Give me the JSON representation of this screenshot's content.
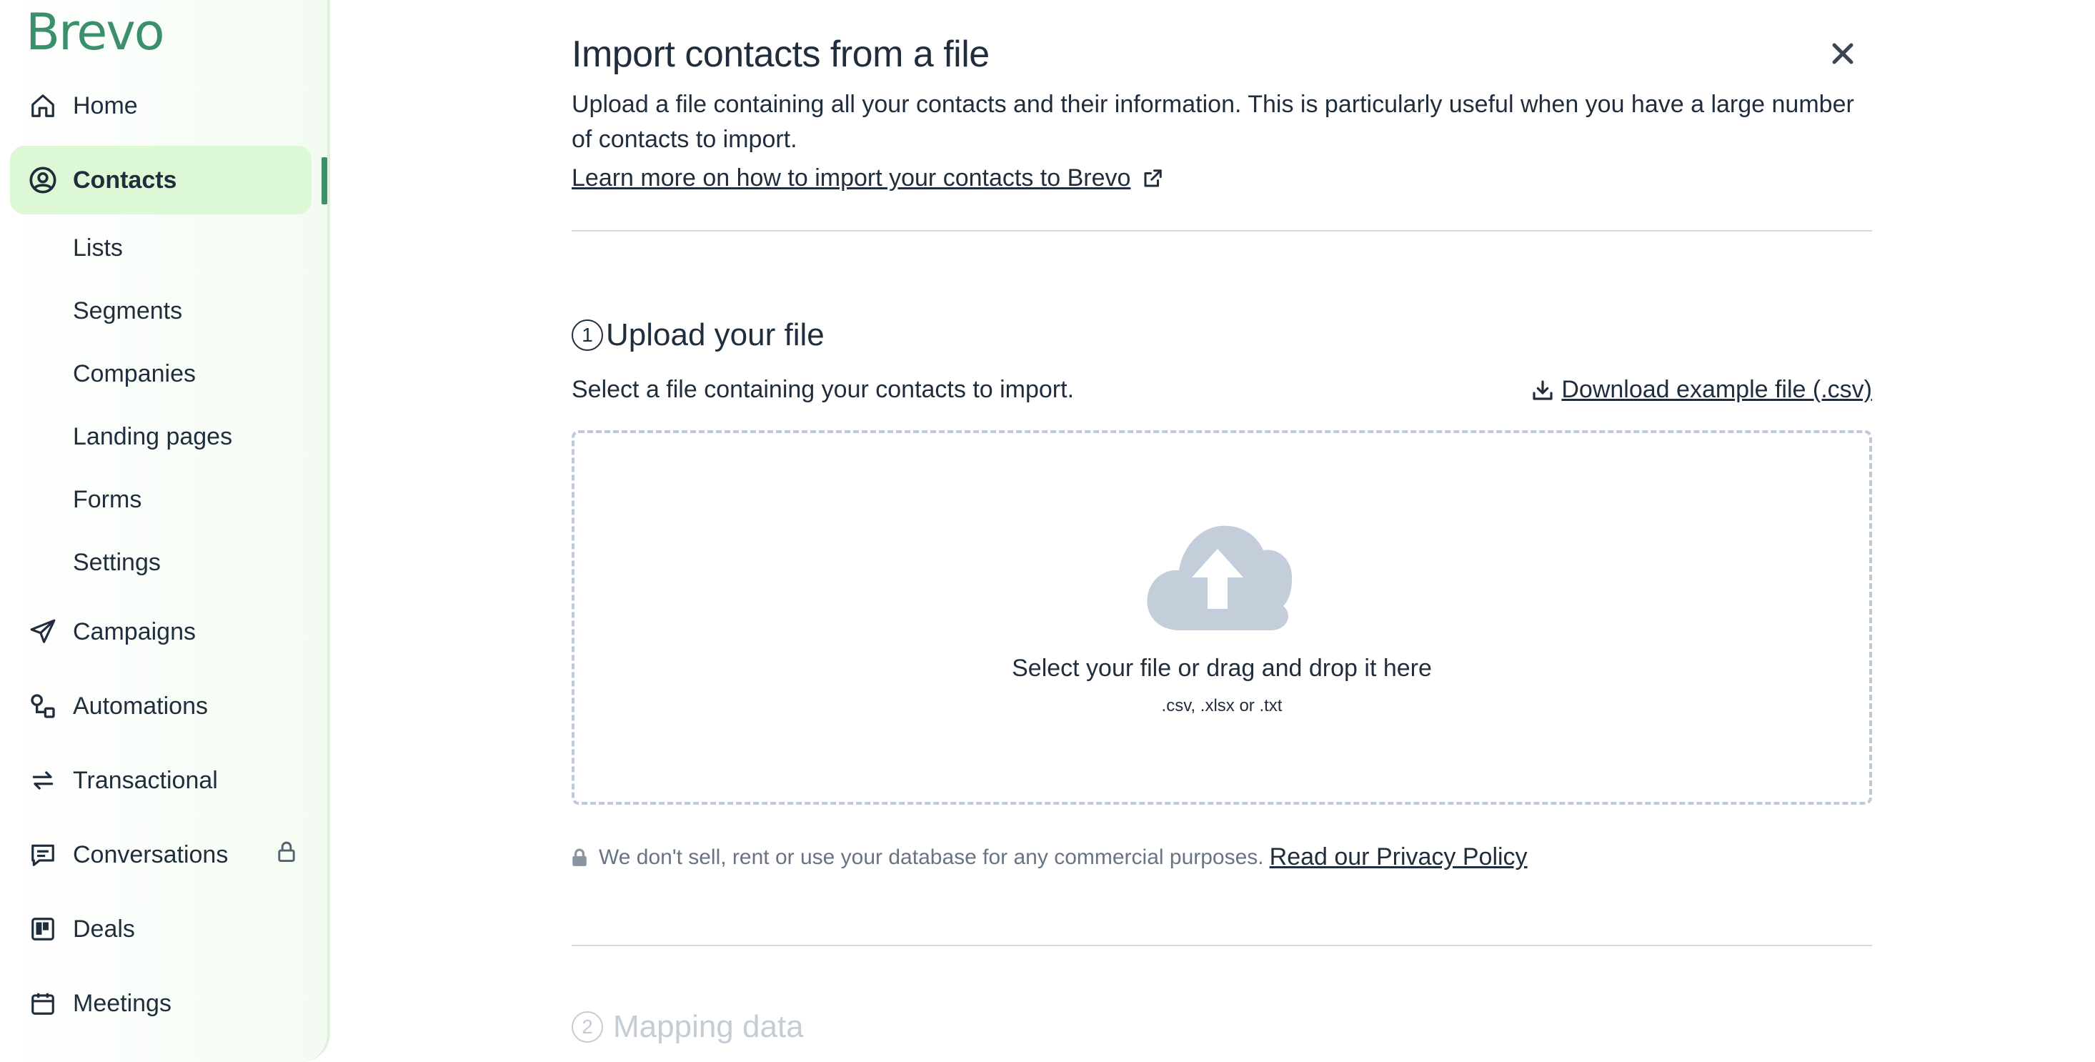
{
  "sidebar": {
    "logo": "Brevo",
    "nav": [
      {
        "label": "Home",
        "icon": "home-icon"
      },
      {
        "label": "Contacts",
        "icon": "contacts-icon",
        "active": true
      },
      {
        "label": "Campaigns",
        "icon": "send-icon"
      },
      {
        "label": "Automations",
        "icon": "automations-icon"
      },
      {
        "label": "Transactional",
        "icon": "transactional-icon"
      },
      {
        "label": "Conversations",
        "icon": "chat-icon",
        "locked": true
      },
      {
        "label": "Deals",
        "icon": "deals-icon"
      },
      {
        "label": "Meetings",
        "icon": "calendar-icon"
      }
    ],
    "contacts_sub": [
      "Lists",
      "Segments",
      "Companies",
      "Landing pages",
      "Forms",
      "Settings"
    ]
  },
  "main": {
    "title": "Import contacts from a file",
    "description": "Upload a file containing all your contacts and their information. This is particularly useful when you have a large number of contacts to import.",
    "learn_more": "Learn more on how to import your contacts to Brevo",
    "step1": {
      "number": "1",
      "title": "Upload your file",
      "instruction": "Select a file containing your contacts to import.",
      "download_label": "Download example file (.csv)",
      "dropzone_text": "Select your file or drag and drop it here",
      "dropzone_formats": ".csv, .xlsx or .txt"
    },
    "privacy_text": "We don't sell, rent or use your database for any commercial purposes.",
    "privacy_link": "Read our Privacy Policy",
    "step2": {
      "number": "2",
      "title": "Mapping data"
    }
  },
  "colors": {
    "brand": "#3b8f6b",
    "active_bg": "#dcf8d4",
    "text": "#1f2d3d",
    "muted": "#687484",
    "cloud": "#c4cedb"
  }
}
